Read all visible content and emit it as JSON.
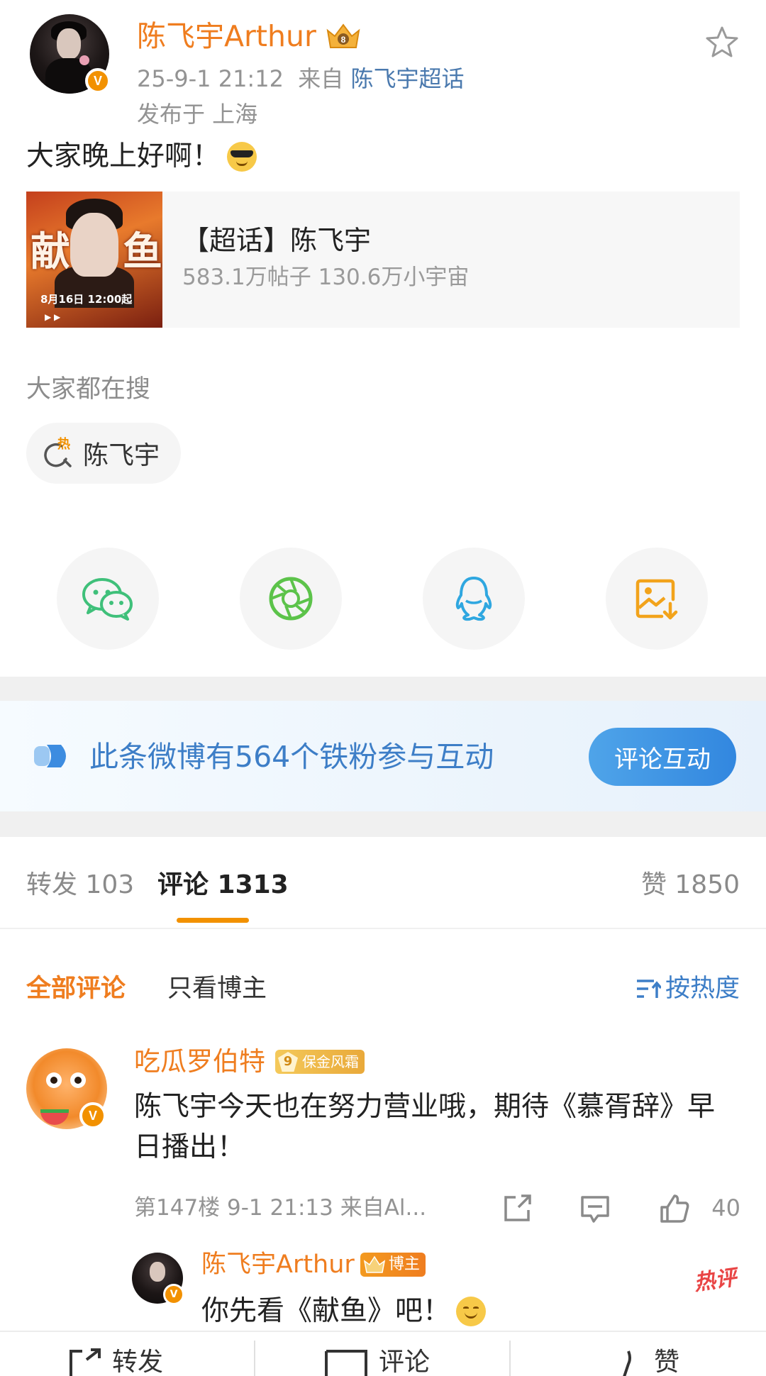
{
  "post": {
    "author_name": "陈飞宇Arthur",
    "verified_badge": "V",
    "timestamp": "25-9-1 21:12",
    "from_label": "来自",
    "source": "陈飞宇超话",
    "location": "发布于 上海",
    "text": "大家晚上好啊！",
    "icons": [
      "crown-icon",
      "star-icon",
      "sunglasses-emoji-icon"
    ]
  },
  "supertopic_card": {
    "title": "【超话】陈飞宇",
    "stats": "583.1万帖子 130.6万小宇宙",
    "poster_date": "8月16日 12:00起"
  },
  "search": {
    "title": "大家都在搜",
    "chip_hot_badge": "热",
    "chip_label": "陈飞宇"
  },
  "share": {
    "icons": [
      "wechat-icon",
      "moments-icon",
      "qq-icon",
      "save-image-icon"
    ],
    "colors": {
      "wechat": "#3fc07a",
      "moments": "#5cc34a",
      "qq": "#2fa7e0",
      "save": "#f2a31b"
    }
  },
  "fan_banner": {
    "text": "此条微博有564个铁粉参与互动",
    "button_label": "评论互动"
  },
  "tabs": {
    "repost": "转发 103",
    "comments": "评论 1313",
    "likes": "赞 1850"
  },
  "filters": {
    "all": "全部评论",
    "blogger_only": "只看博主",
    "sort": "按热度"
  },
  "comment": {
    "name": "吃瓜罗伯特",
    "badge_level": "9",
    "badge_label": "保金风霜",
    "text": "陈飞宇今天也在努力营业哦，期待《慕胥辞》早日播出！",
    "meta": "第147楼  9-1 21:13  来自Al...",
    "like_count": "40"
  },
  "reply": {
    "name": "陈飞宇Arthur",
    "badge_label": "博主",
    "text": "你先看《献鱼》吧！",
    "hot_stamp": "热评"
  },
  "bottom_bar": {
    "repost": "转发",
    "comment": "评论",
    "like": "赞"
  },
  "colors": {
    "orange_accent": "#ef7d1f",
    "link_blue": "#3d7ec7",
    "tab_underline": "#f29100"
  }
}
